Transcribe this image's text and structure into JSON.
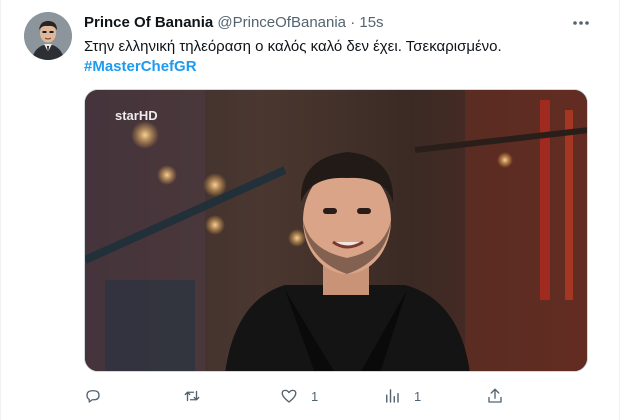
{
  "tweet": {
    "display_name": "Prince Of Banania",
    "handle": "@PrinceOfBanania",
    "separator": "·",
    "time": "15s",
    "text": "Στην ελληνική τηλεόραση ο καλός καλό δεν έχει. Τσεκαρισμένο.",
    "hashtag": "#MasterChefGR",
    "media": {
      "watermark": "starHD",
      "icon": "video-frame-image"
    }
  },
  "actions": {
    "reply": {
      "icon": "reply-icon",
      "count": ""
    },
    "retweet": {
      "icon": "retweet-icon",
      "count": ""
    },
    "like": {
      "icon": "heart-icon",
      "count": "1"
    },
    "views": {
      "icon": "views-icon",
      "count": "1"
    },
    "share": {
      "icon": "share-icon",
      "count": ""
    }
  },
  "colors": {
    "accent": "#1d9bf0",
    "secondary_text": "#536471",
    "primary_text": "#0f1419"
  }
}
